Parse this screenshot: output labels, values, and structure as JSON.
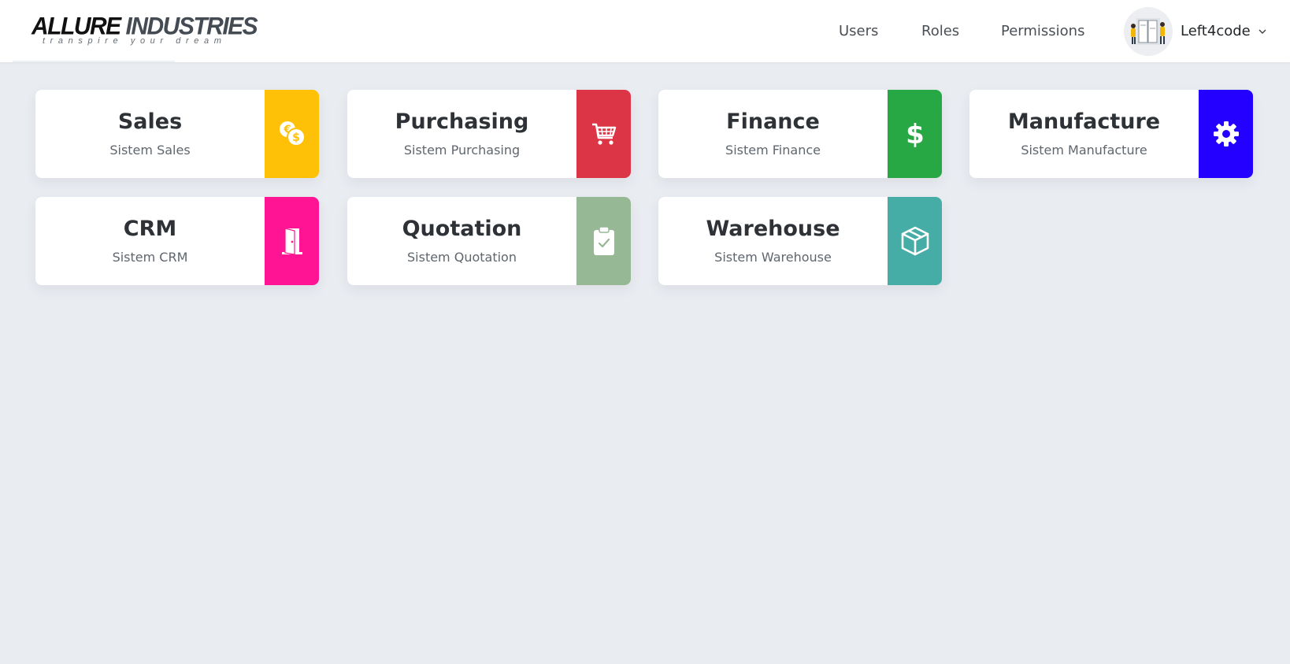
{
  "brand": {
    "name_part1": "ALLURE",
    "name_part2": "INDUSTRIES",
    "tagline": "transpire your dream"
  },
  "nav": {
    "items": [
      {
        "label": "Users"
      },
      {
        "label": "Roles"
      },
      {
        "label": "Permissions"
      }
    ]
  },
  "user": {
    "name": "Left4code"
  },
  "modules": [
    {
      "title": "Sales",
      "subtitle": "Sistem Sales",
      "icon": "coins-icon",
      "color": "#ffc107"
    },
    {
      "title": "Purchasing",
      "subtitle": "Sistem Purchasing",
      "icon": "cart-icon",
      "color": "#dc3545"
    },
    {
      "title": "Finance",
      "subtitle": "Sistem Finance",
      "icon": "dollar-icon",
      "color": "#28a745"
    },
    {
      "title": "Manufacture",
      "subtitle": "Sistem Manufacture",
      "icon": "gear-icon",
      "color": "#2300ff"
    },
    {
      "title": "CRM",
      "subtitle": "Sistem CRM",
      "icon": "door-icon",
      "color": "#ff1493"
    },
    {
      "title": "Quotation",
      "subtitle": "Sistem Quotation",
      "icon": "clipboard-check-icon",
      "color": "#97b895"
    },
    {
      "title": "Warehouse",
      "subtitle": "Sistem Warehouse",
      "icon": "box-icon",
      "color": "#45aca6"
    }
  ]
}
